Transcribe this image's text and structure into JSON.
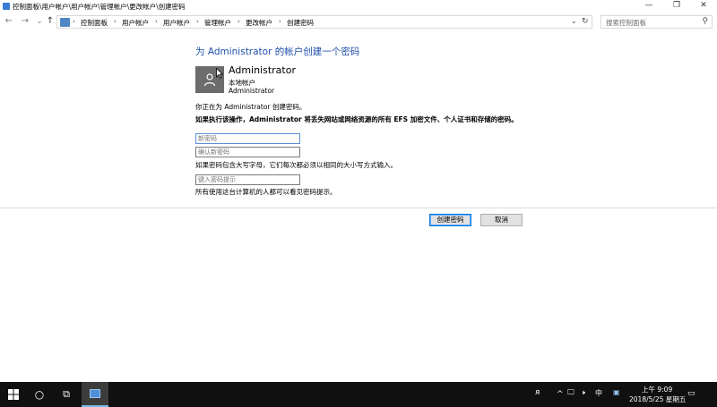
{
  "window": {
    "title": "控制面板\\用户帐户\\用户帐户\\管理帐户\\更改帐户\\创建密码",
    "minimize_icon": "—",
    "maximize_icon": "❐",
    "close_icon": "✕"
  },
  "nav": {
    "back_icon": "←",
    "forward_icon": "→",
    "recent_icon": "⌄",
    "up_icon": "↑",
    "breadcrumbs": [
      "控制面板",
      "用户帐户",
      "用户帐户",
      "管理帐户",
      "更改帐户",
      "创建密码"
    ],
    "separator": "›",
    "dropdown_icon": "⌄",
    "refresh_icon": "↻",
    "search_placeholder": "搜索控制面板",
    "search_icon": "⚲"
  },
  "content": {
    "heading": "为 Administrator 的帐户创建一个密码",
    "account_name": "Administrator",
    "account_type": "本地帐户",
    "account_group": "Administrator",
    "creating_text": "你正在为 Administrator 创建密码。",
    "warning_text": "如果执行该操作，Administrator 将丢失网站或网络资源的所有 EFS 加密文件、个人证书和存储的密码。",
    "new_password_placeholder": "新密码",
    "confirm_password_placeholder": "确认新密码",
    "case_note": "如果密码包含大写字母，它们每次都必须以相同的大小写方式输入。",
    "hint_placeholder": "键入密码提示",
    "hint_note": "所有使用这台计算机的人都可以看见密码提示。",
    "create_button": "创建密码",
    "cancel_button": "取消"
  },
  "taskbar": {
    "start_icon": "windows-logo",
    "search_icon": "○",
    "taskview_icon": "⧉",
    "tray_people": "ᴙ",
    "tray_chevron": "^",
    "tray_network": "🖵",
    "tray_volume": "🕨",
    "tray_ime": "中",
    "tray_keyboard": "▣",
    "time": "上午 9:09",
    "date": "2018/5/25 星期五",
    "notification_icon": "▭"
  },
  "colors": {
    "heading": "#1e4fa8",
    "taskbar": "#101010",
    "primary_button_border": "#0078d7"
  }
}
